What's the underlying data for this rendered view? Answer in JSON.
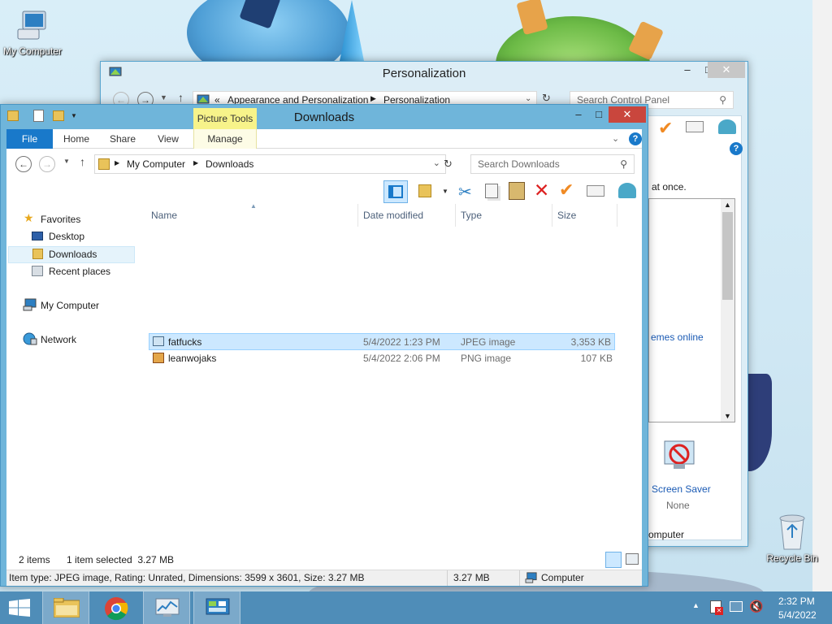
{
  "desktop": {
    "icons": [
      {
        "label": "My Computer"
      },
      {
        "label": "Recycle Bin"
      }
    ]
  },
  "personalization": {
    "title": "Personalization",
    "breadcrumb": [
      "«",
      "Appearance and Personalization",
      "Personalization"
    ],
    "search_placeholder": "Search Control Panel",
    "partial_texts": {
      "at_once": "at once.",
      "themes_online": "emes online",
      "screen_saver": "Screen Saver",
      "screen_saver_value": "None",
      "computer": "omputer"
    }
  },
  "downloads": {
    "title": "Downloads",
    "context_tab": "Picture Tools",
    "tabs": {
      "file": "File",
      "home": "Home",
      "share": "Share",
      "view": "View",
      "manage": "Manage"
    },
    "breadcrumb": [
      "My Computer",
      "Downloads"
    ],
    "search_placeholder": "Search Downloads",
    "nav": {
      "favorites": "Favorites",
      "desktop": "Desktop",
      "downloads": "Downloads",
      "recent": "Recent places",
      "computer": "My Computer",
      "network": "Network"
    },
    "columns": {
      "name": "Name",
      "date": "Date modified",
      "type": "Type",
      "size": "Size"
    },
    "files": [
      {
        "name": "fatfucks",
        "date": "5/4/2022 1:23 PM",
        "type": "JPEG image",
        "size": "3,353 KB"
      },
      {
        "name": "leanwojaks",
        "date": "5/4/2022 2:06 PM",
        "type": "PNG image",
        "size": "107 KB"
      }
    ],
    "status": {
      "items": "2 items",
      "selected": "1 item selected  3.27 MB"
    },
    "infobar": {
      "details": "Item type: JPEG image, Rating: Unrated, Dimensions: 3599 x 3601, Size: 3.27 MB",
      "size": "3.27 MB",
      "location": "Computer"
    }
  },
  "taskbar": {
    "time": "2:32 PM",
    "date": "5/4/2022"
  }
}
